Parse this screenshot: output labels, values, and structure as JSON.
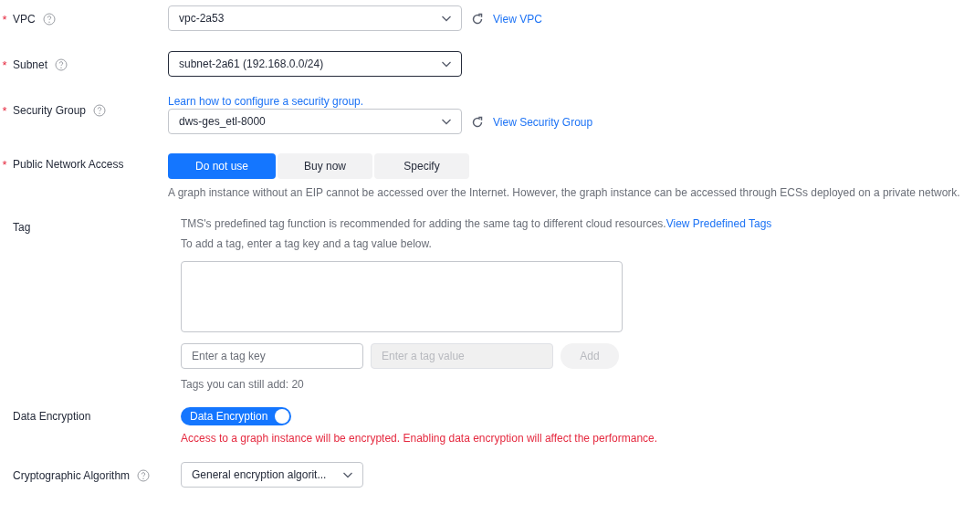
{
  "fields": [
    {
      "kind": "select",
      "label": "VPC",
      "required_mark": "*",
      "help": true,
      "value": "vpc-2a53",
      "focused": false,
      "refresh": true,
      "link": "View VPC"
    },
    {
      "kind": "select",
      "label": "Subnet",
      "required_mark": "*",
      "help": true,
      "value": "subnet-2a61 (192.168.0.0/24)",
      "focused": true
    },
    {
      "kind": "select",
      "label": "Security Group",
      "required_mark": "*",
      "help": true,
      "top_link": "Learn how to configure a security group.",
      "value": "dws-ges_etl-8000",
      "focused": false,
      "refresh": true,
      "link": "View Security Group"
    },
    {
      "kind": "segmented",
      "label": "Public Network Access",
      "required_mark": "*",
      "options": [
        {
          "label": "Do not use",
          "selected": true
        },
        {
          "label": "Buy now",
          "selected": false
        },
        {
          "label": "Specify",
          "selected": false
        }
      ],
      "hint": "A graph instance without an EIP cannot be accessed over the Internet. However, the graph instance can be accessed through ECSs deployed on a private network."
    },
    {
      "kind": "tags",
      "label": "Tag",
      "intro": "TMS's predefined tag function is recommended for adding the same tag to different cloud resources.",
      "intro_link": "View Predefined Tags",
      "instruction": "To add a tag, enter a tag key and a tag value below.",
      "key_placeholder": "Enter a tag key",
      "value_placeholder": "Enter a tag value",
      "value_disabled": true,
      "add_button": "Add",
      "add_disabled": true,
      "remaining": "Tags you can still add: 20"
    },
    {
      "kind": "toggle",
      "label": "Data Encryption",
      "switch_label": "Data Encryption",
      "on": true,
      "warning": "Access to a graph instance will be encrypted. Enabling data encryption will affect the performance."
    },
    {
      "kind": "select",
      "label": "Cryptographic Algorithm",
      "help": true,
      "value": "General encryption algorit...",
      "focused": false,
      "narrow": true
    }
  ]
}
